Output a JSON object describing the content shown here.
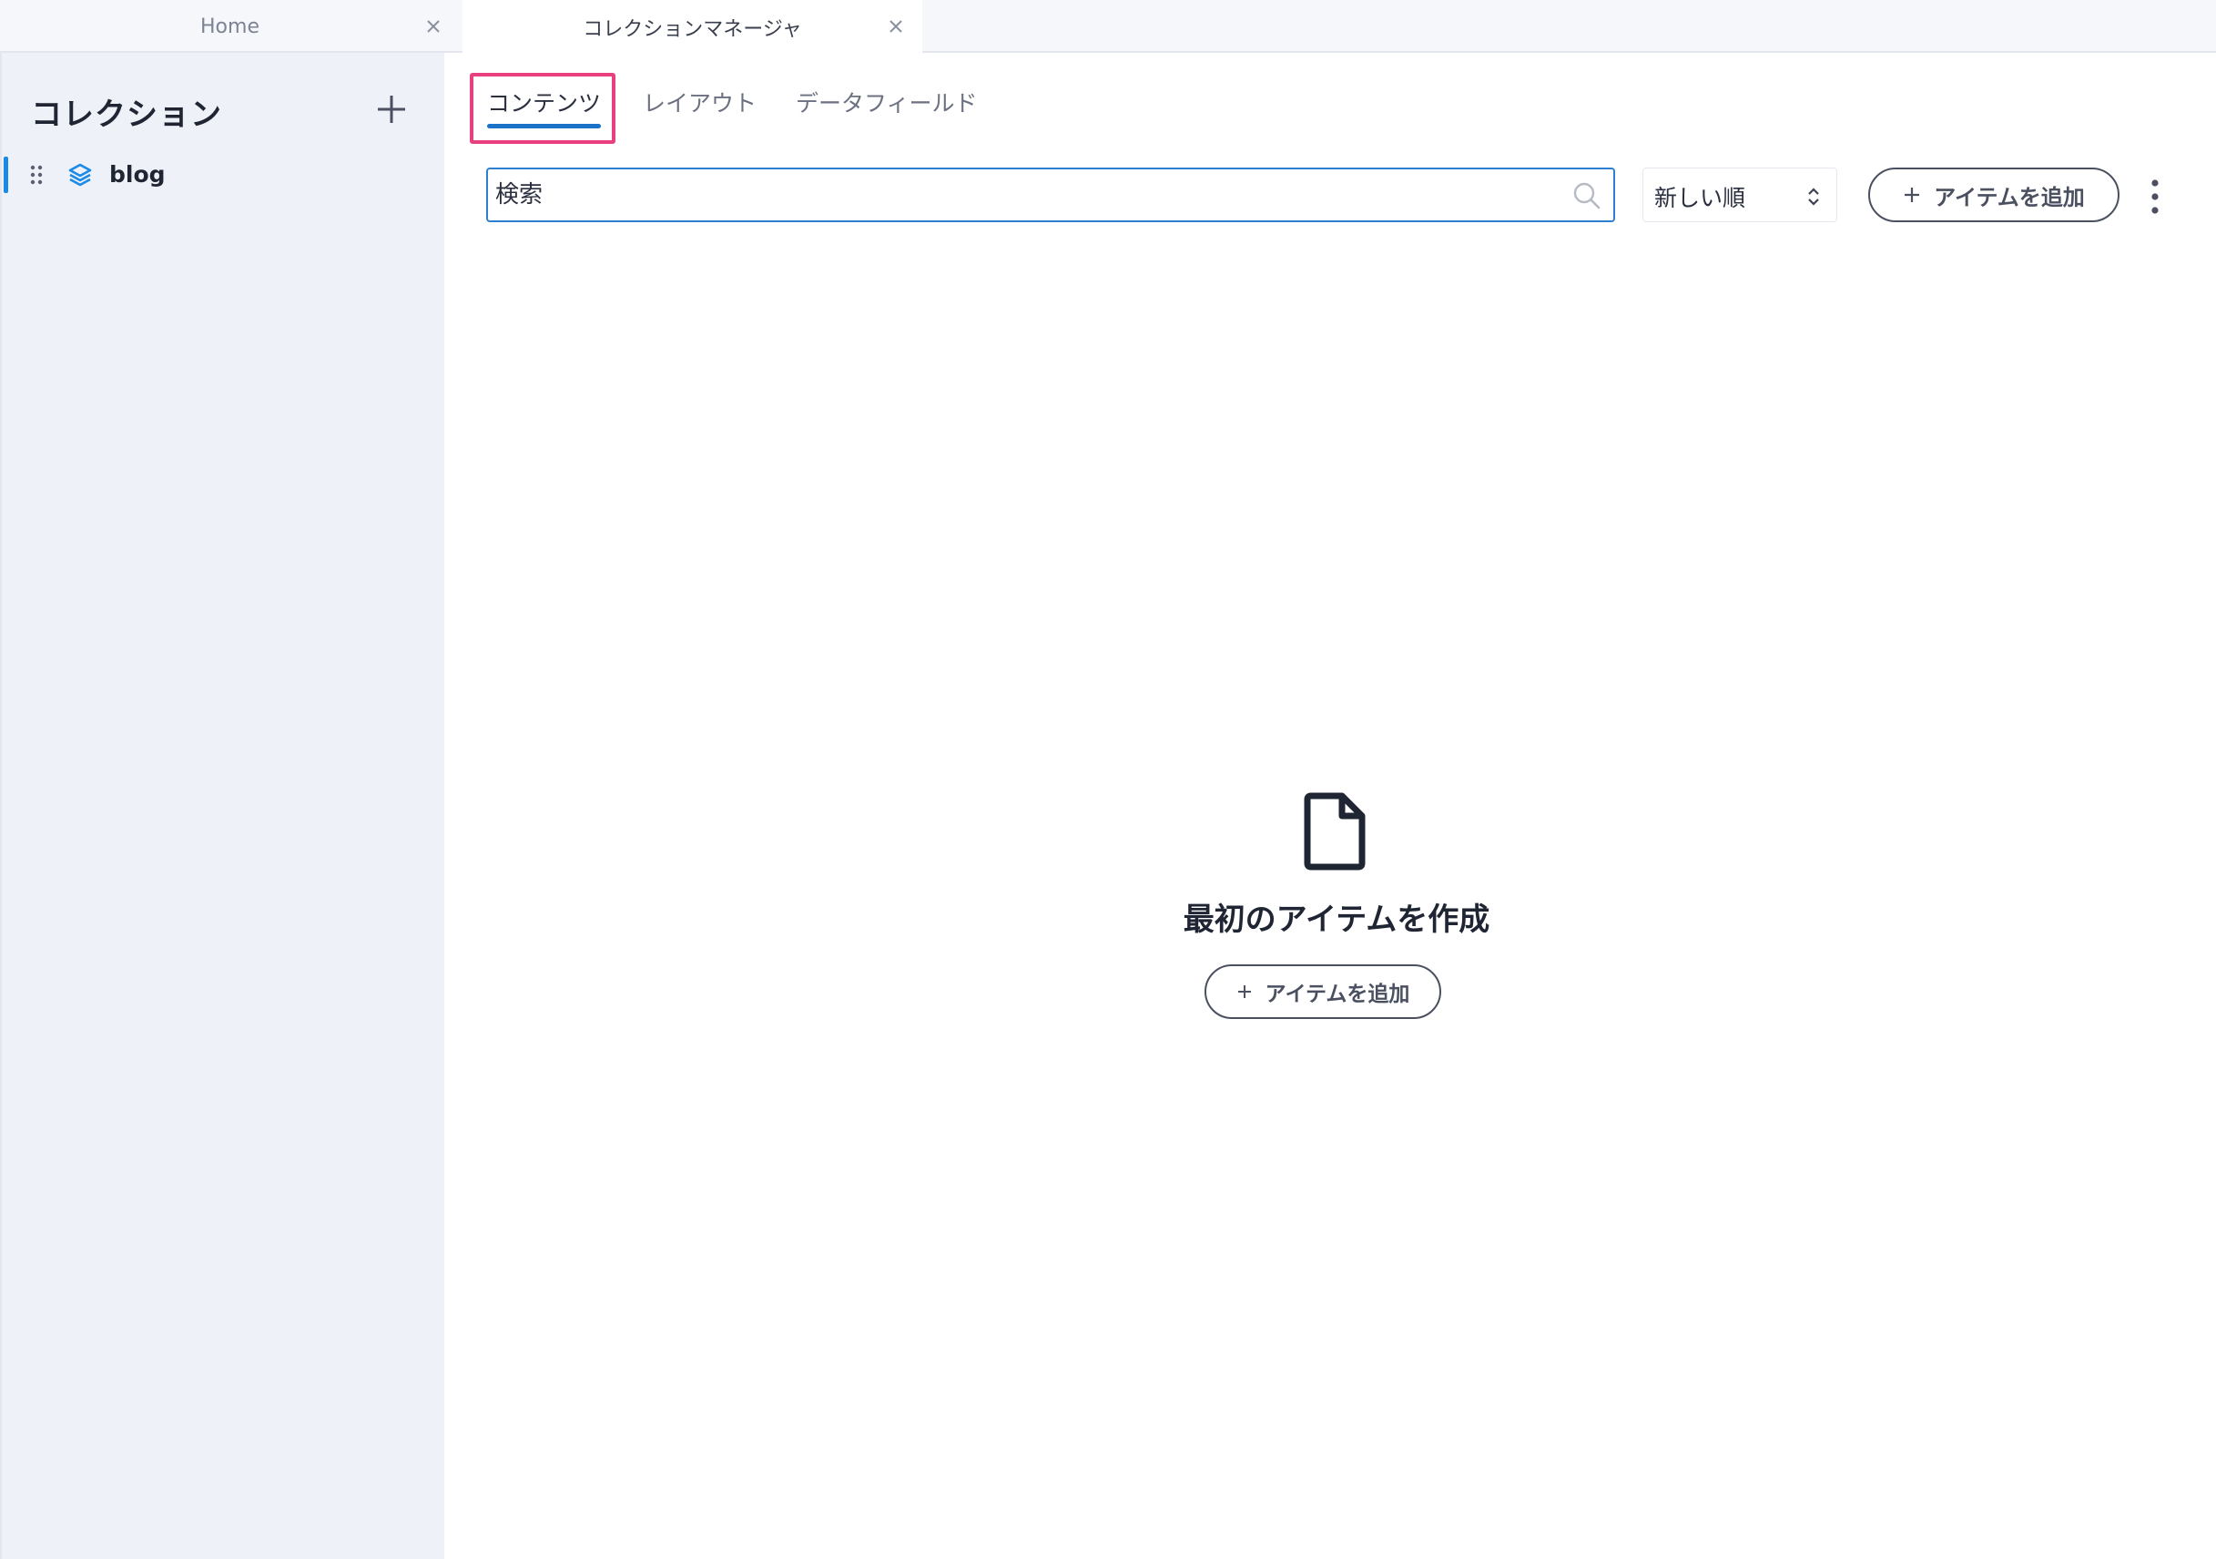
{
  "window_tabs": [
    {
      "label": "Home"
    },
    {
      "label": "コレクションマネージャ"
    }
  ],
  "sidebar": {
    "title": "コレクション",
    "items": [
      {
        "label": "blog"
      }
    ]
  },
  "page_tabs": [
    {
      "label": "コンテンツ"
    },
    {
      "label": "レイアウト"
    },
    {
      "label": "データフィールド"
    }
  ],
  "toolbar": {
    "search_placeholder": "検索",
    "sort_value": "新しい順",
    "add_item_label": "アイテムを追加"
  },
  "empty_state": {
    "title": "最初のアイテムを作成",
    "button_label": "アイテムを追加"
  },
  "colors": {
    "accent": "#1a73c9",
    "highlight": "#e8407e",
    "sidebar_bg": "#eef1f8"
  },
  "icons": [
    "close-icon",
    "plus-icon",
    "drag-handle-icon",
    "layers-icon",
    "search-icon",
    "sort-chevron-icon",
    "more-vertical-icon",
    "document-icon"
  ]
}
